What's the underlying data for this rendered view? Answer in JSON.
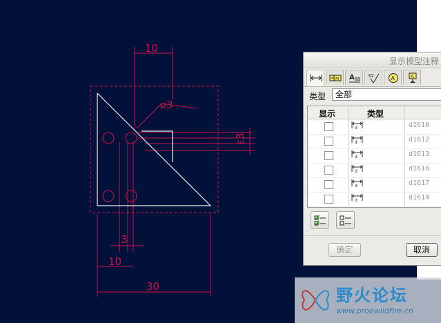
{
  "drawing": {
    "dim_top": "10",
    "dim_hole": "⌀3",
    "dim_right": "ε3",
    "dim_small": "3",
    "dim_bottom_left": "10",
    "dim_overall": "30"
  },
  "dialog": {
    "title": "显示模型注释",
    "tabs": [
      {
        "icon": "dimension-icon",
        "active": true
      },
      {
        "icon": "gtol-icon"
      },
      {
        "icon": "note-icon"
      },
      {
        "icon": "surface-finish-icon"
      },
      {
        "icon": "datum-target-icon"
      },
      {
        "icon": "datum-icon"
      }
    ],
    "type_label": "类型",
    "type_value": "全部",
    "columns": {
      "show": "显示",
      "type": "类型"
    },
    "rows": [
      {
        "id": "d1610",
        "checked": false
      },
      {
        "id": "d1612",
        "checked": false
      },
      {
        "id": "d1613",
        "checked": false
      },
      {
        "id": "d1616",
        "checked": false
      },
      {
        "id": "d1617",
        "checked": false
      },
      {
        "id": "d1614",
        "checked": false
      }
    ],
    "ok_label": "确定",
    "cancel_label": "取消"
  },
  "watermark": {
    "title": "野火论坛",
    "url": "www.proewildfire.cn"
  }
}
